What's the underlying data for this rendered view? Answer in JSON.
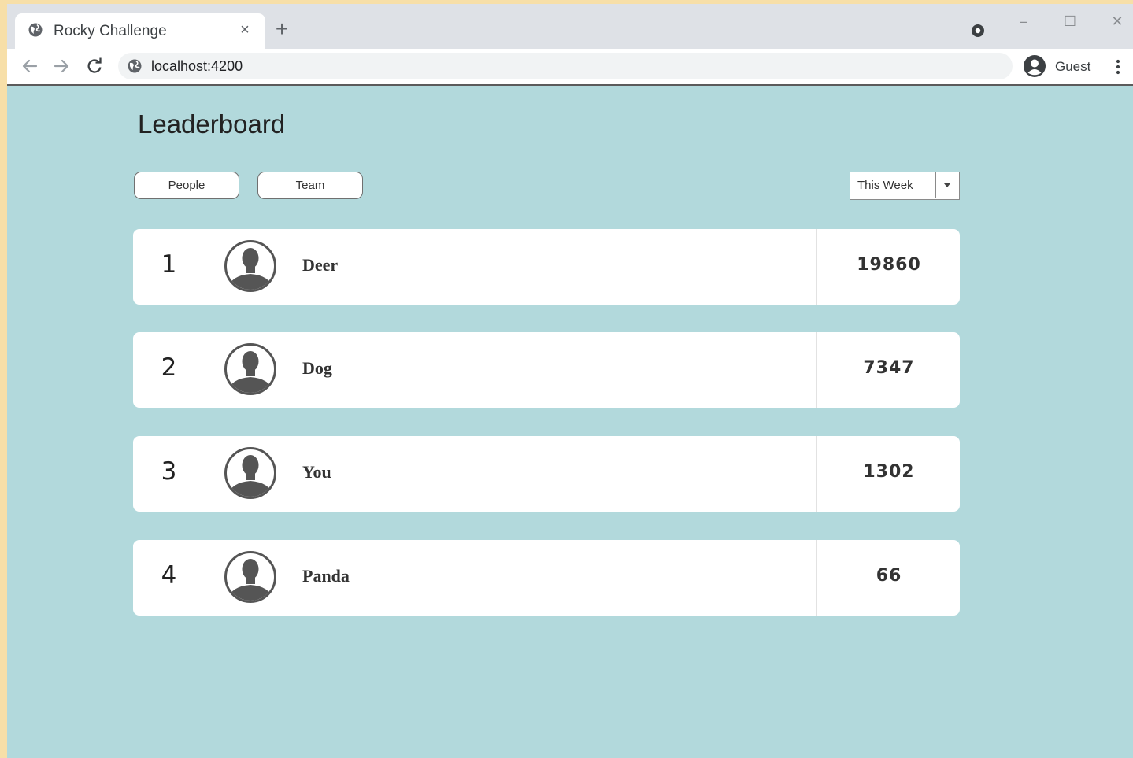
{
  "browser": {
    "tab_title": "Rocky Challenge",
    "tab_close": "×",
    "new_tab": "+",
    "url": "localhost:4200",
    "profile_name": "Guest",
    "window_controls": {
      "minimize": "–",
      "maximize": "☐",
      "close": "✕"
    },
    "icons": [
      "globe-icon",
      "extension-icon",
      "back-arrow-icon",
      "forward-arrow-icon",
      "reload-icon",
      "profile-icon",
      "kebab-menu-icon"
    ]
  },
  "leaderboard": {
    "title": "Leaderboard",
    "tabs": [
      {
        "label": "People"
      },
      {
        "label": "Team"
      }
    ],
    "period_select": {
      "value": "This Week"
    },
    "rows": [
      {
        "rank": "1",
        "name": "Deer",
        "score": "19860"
      },
      {
        "rank": "2",
        "name": "Dog",
        "score": "7347"
      },
      {
        "rank": "3",
        "name": "You",
        "score": "1302"
      },
      {
        "rank": "4",
        "name": "Panda",
        "score": "66"
      }
    ]
  },
  "colors": {
    "page_background": "#b2d9dc",
    "card_background": "#ffffff",
    "browser_chrome": "#dee1e6",
    "avatar": "#555555"
  }
}
